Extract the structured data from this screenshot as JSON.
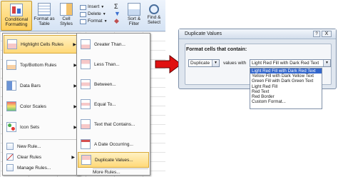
{
  "ribbon": {
    "conditional_formatting": "Conditional Formatting",
    "format_as_table": "Format as Table",
    "cell_styles": "Cell Styles",
    "insert": "Insert",
    "delete": "Delete",
    "format": "Format",
    "sigma": "Σ",
    "sort_filter": "Sort & Filter",
    "find_select": "Find & Select"
  },
  "menu": {
    "items": [
      {
        "label": "Highlight Cells Rules",
        "icon": "highlight-cells-icon"
      },
      {
        "label": "Top/Bottom Rules",
        "icon": "top-bottom-icon"
      },
      {
        "label": "Data Bars",
        "icon": "data-bars-icon"
      },
      {
        "label": "Color Scales",
        "icon": "color-scales-icon"
      },
      {
        "label": "Icon Sets",
        "icon": "icon-sets-icon"
      }
    ],
    "actions": [
      {
        "label": "New Rule..."
      },
      {
        "label": "Clear Rules"
      },
      {
        "label": "Manage Rules..."
      }
    ]
  },
  "submenu": {
    "items": [
      {
        "label": "Greater Than..."
      },
      {
        "label": "Less Than..."
      },
      {
        "label": "Between..."
      },
      {
        "label": "Equal To..."
      },
      {
        "label": "Text that Contains..."
      },
      {
        "label": "A Date Occurring..."
      },
      {
        "label": "Duplicate Values..."
      }
    ],
    "more": "More Rules..."
  },
  "dialog": {
    "title": "Duplicate Values",
    "help": "?",
    "close": "X",
    "group_label": "Format cells that contain:",
    "type_value": "Duplicate",
    "values_with": "values with",
    "format_value": "Light Red Fill with Dark Red Text",
    "options": [
      "Light Red Fill with Dark Red Text",
      "Yellow Fill with Dark Yellow Text",
      "Green Fill with Dark Green Text",
      "Light Red Fill",
      "Red Text",
      "Red Border",
      "Custom Format..."
    ]
  },
  "colors": {
    "highlight": "#ffd978",
    "selection": "#3366cc",
    "arrow": "#e01010"
  }
}
